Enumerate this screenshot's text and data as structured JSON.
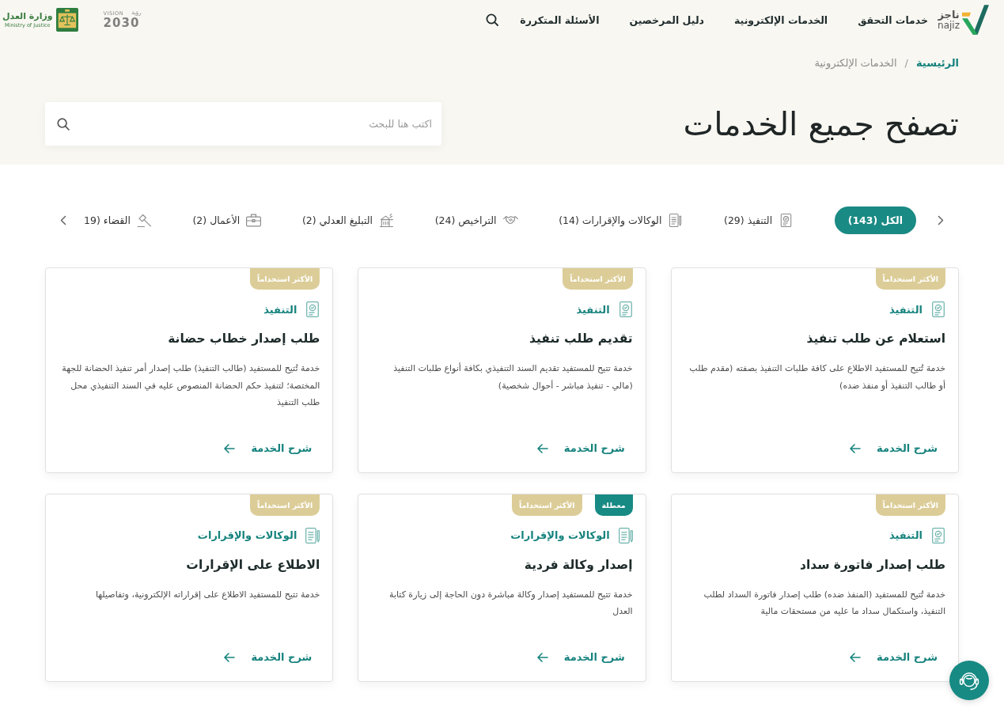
{
  "header": {
    "logo": {
      "arabic": "ناجز",
      "latin": "najiz"
    },
    "nav": [
      "خدمات التحقق",
      "الخدمات الإلكترونية",
      "دليل المرخصين",
      "الأسئلة المتكررة"
    ],
    "partner_logos": [
      {
        "kind": "vision",
        "label": "VISION",
        "arabic": "رؤية",
        "year": "2030"
      },
      {
        "kind": "ministry",
        "arabic": "وزارة العدل",
        "english": "Ministry of Justice"
      }
    ]
  },
  "breadcrumb": {
    "separator": "/",
    "items": [
      {
        "label": "الرئيسية",
        "current": false
      },
      {
        "label": "الخدمات الإلكترونية",
        "current": true
      }
    ]
  },
  "page_title": "تصفح جميع الخدمات",
  "search": {
    "placeholder": "اكتب هنا للبحث"
  },
  "categories": [
    {
      "label": "الكل (143)",
      "kind": "all",
      "selected": true
    },
    {
      "label": "التنفيذ (29)",
      "kind": "execution",
      "selected": false
    },
    {
      "label": "الوكالات والإقرارات (14)",
      "kind": "agencies",
      "selected": false
    },
    {
      "label": "التراخيص (24)",
      "kind": "licenses",
      "selected": false
    },
    {
      "label": "التبليغ العدلي (2)",
      "kind": "notification",
      "selected": false
    },
    {
      "label": "الأعمال (2)",
      "kind": "business",
      "selected": false
    },
    {
      "label": "القضاء (19",
      "kind": "judiciary",
      "selected": false
    }
  ],
  "services": [
    {
      "badges": [
        {
          "label": "الأكثر استخداماً",
          "kind": "popular"
        }
      ],
      "category": {
        "label": "التنفيذ",
        "kind": "execution"
      },
      "title": "استعلام عن طلب تنفيذ",
      "description": "خدمة تُتيح للمستفيد الاطلاع على كافة طلبات التنفيذ بصفته (مقدم طلب أو طالب التنفيذ أو منفذ ضده)",
      "link": "شرح الخدمة"
    },
    {
      "badges": [
        {
          "label": "الأكثر استخداماً",
          "kind": "popular"
        }
      ],
      "category": {
        "label": "التنفيذ",
        "kind": "execution"
      },
      "title": "تقديم طلب تنفيذ",
      "description": "خدمة تتيح للمستفيد تقديم السند التنفيذي بكافة أنواع طلبات التنفيذ (مالي - تنفيذ مباشر - أحوال شخصية)",
      "link": "شرح الخدمة"
    },
    {
      "badges": [
        {
          "label": "الأكثر استخداماً",
          "kind": "popular"
        }
      ],
      "category": {
        "label": "التنفيذ",
        "kind": "execution"
      },
      "title": "طلب إصدار خطاب حضانة",
      "description": "خدمة تُتيح للمستفيد (طالب التنفيذ) طلب إصدار أمر تنفيذ الحضانة للجهة المختصة؛ لتنفيذ حكم الحضانة المنصوص عليه في السند التنفيذي محل طلب التنفيذ",
      "link": "شرح الخدمة"
    },
    {
      "badges": [
        {
          "label": "الأكثر استخداماً",
          "kind": "popular"
        }
      ],
      "category": {
        "label": "التنفيذ",
        "kind": "execution"
      },
      "title": "طلب إصدار فاتورة سداد",
      "description": "خدمة تُتيح للمستفيد (المنفذ ضده) طلب إصدار فاتورة السداد لطلب التنفيذ، واستكمال سداد ما عليه من مستحقات مالية",
      "link": "شرح الخدمة"
    },
    {
      "badges": [
        {
          "label": "معطلة",
          "kind": "disabled"
        },
        {
          "label": "الأكثر استخداماً",
          "kind": "popular"
        }
      ],
      "category": {
        "label": "الوكالات والإقرارات",
        "kind": "agencies"
      },
      "title": "إصدار وكالة فردية",
      "description": "خدمة تتيح للمستفيد إصدار وكالة مباشرة دون الحاجة إلى زيارة كتابة العدل",
      "link": "شرح الخدمة"
    },
    {
      "badges": [
        {
          "label": "الأكثر استخداماً",
          "kind": "popular"
        }
      ],
      "category": {
        "label": "الوكالات والإقرارات",
        "kind": "agencies"
      },
      "title": "الاطلاع على الإقرارات",
      "description": "خدمة تتيح للمستفيد الاطلاع على إقراراته الإلكترونية، وتفاصيلها",
      "link": "شرح الخدمة"
    }
  ]
}
